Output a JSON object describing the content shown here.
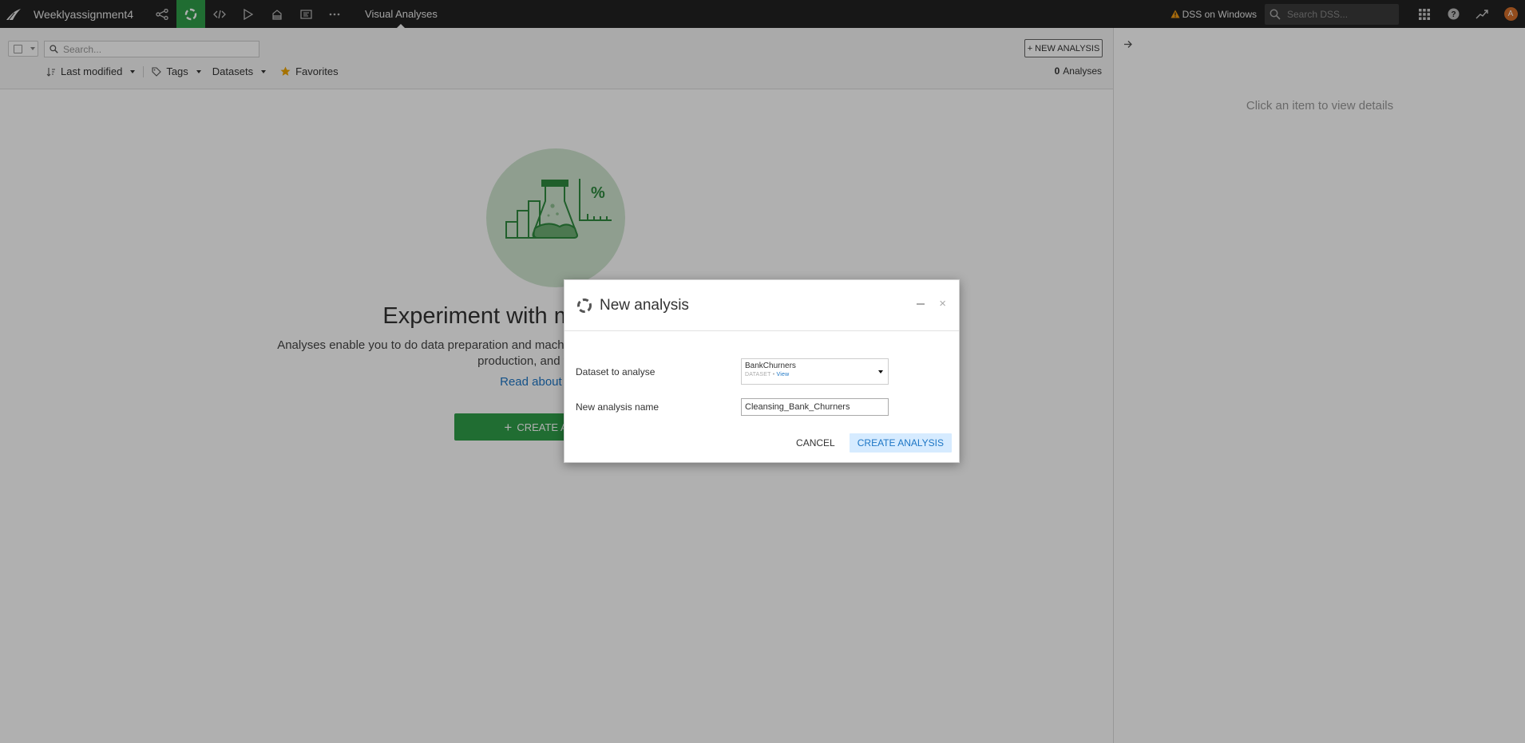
{
  "topnav": {
    "project_name": "Weeklyassignment4",
    "page_title": "Visual Analyses",
    "warning_label": "DSS on Windows",
    "search_placeholder": "Search DSS...",
    "avatar_initial": "A",
    "accent_color": "#2f9e49"
  },
  "toolbar": {
    "search_placeholder": "Search...",
    "new_analysis_label": "+ NEW ANALYSIS",
    "sort_label": "Last modified",
    "tags_label": "Tags",
    "datasets_label": "Datasets",
    "favorites_label": "Favorites",
    "count_value": "0",
    "count_label": "Analyses"
  },
  "empty_state": {
    "title": "Experiment with machine learning",
    "description": "Analyses enable you to do data preparation and machine learning, which you can deploy as a workflow in production, and you can do ...",
    "link_label": "Read about Analyses",
    "button_label": "CREATE ANALYSIS"
  },
  "right_panel": {
    "hint": "Click an item to view details"
  },
  "modal": {
    "title": "New analysis",
    "dataset_label": "Dataset to analyse",
    "dataset_name": "BankChurners",
    "dataset_type": "DATASET",
    "dataset_view_link": "View",
    "name_label": "New analysis name",
    "name_value": "Cleansing_Bank_Churners",
    "cancel_label": "CANCEL",
    "create_label": "CREATE ANALYSIS"
  }
}
